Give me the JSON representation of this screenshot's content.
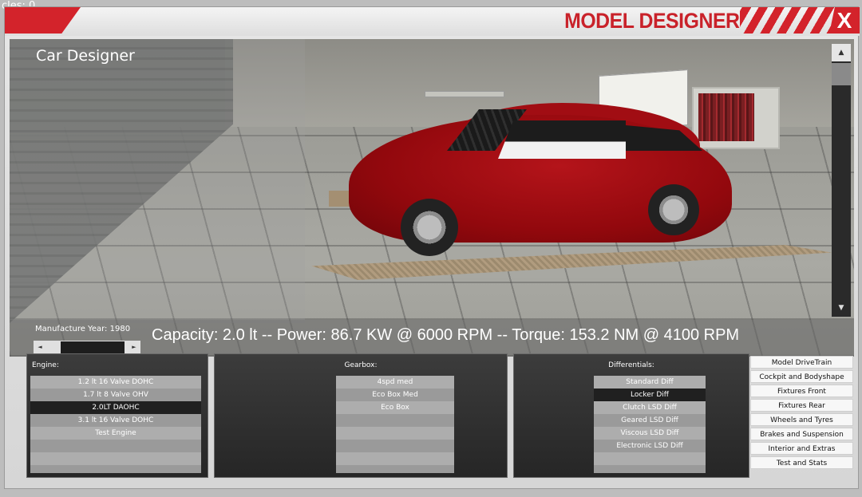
{
  "debug": {
    "text": "cles: 0"
  },
  "window": {
    "title": "MODEL DESIGNER",
    "close_label": "X"
  },
  "viewport": {
    "title": "Car Designer",
    "stats": "Capacity: 2.0 lt -- Power: 86.7 KW @ 6000 RPM -- Torque: 153.2 NM @ 4100 RPM",
    "manufacture_year_label": "Manufacture Year: 1980",
    "scroll_up": "▲",
    "scroll_down": "▼",
    "slider_left": "◄",
    "slider_right": "►"
  },
  "engine": {
    "label": "Engine:",
    "items": [
      "1.2 lt 16 Valve  DOHC",
      "1.7 lt 8 Valve  OHV",
      "2.0LT DAOHC",
      "3.1 lt 16 Valve  DOHC",
      "Test Engine"
    ],
    "selected": "2.0LT DAOHC"
  },
  "gearbox": {
    "label": "Gearbox:",
    "items": [
      "4spd med",
      "Eco Box Med",
      "Eco Box"
    ]
  },
  "differentials": {
    "label": "Differentials:",
    "items": [
      "Standard Diff",
      "Locker Diff",
      "Clutch LSD Diff",
      "Geared LSD Diff",
      "Viscous LSD Diff",
      "Electronic LSD Diff"
    ],
    "selected": "Locker Diff"
  },
  "menu": {
    "items": [
      "Model DriveTrain",
      "Cockpit and Bodyshape",
      "Fixtures Front",
      "Fixtures Rear",
      "Wheels and Tyres",
      "Brakes and Suspension",
      "Interior and Extras",
      "Test and Stats"
    ]
  },
  "colors": {
    "accent": "#d3232b",
    "panel": "#2f2f2f",
    "selected": "#202020"
  }
}
